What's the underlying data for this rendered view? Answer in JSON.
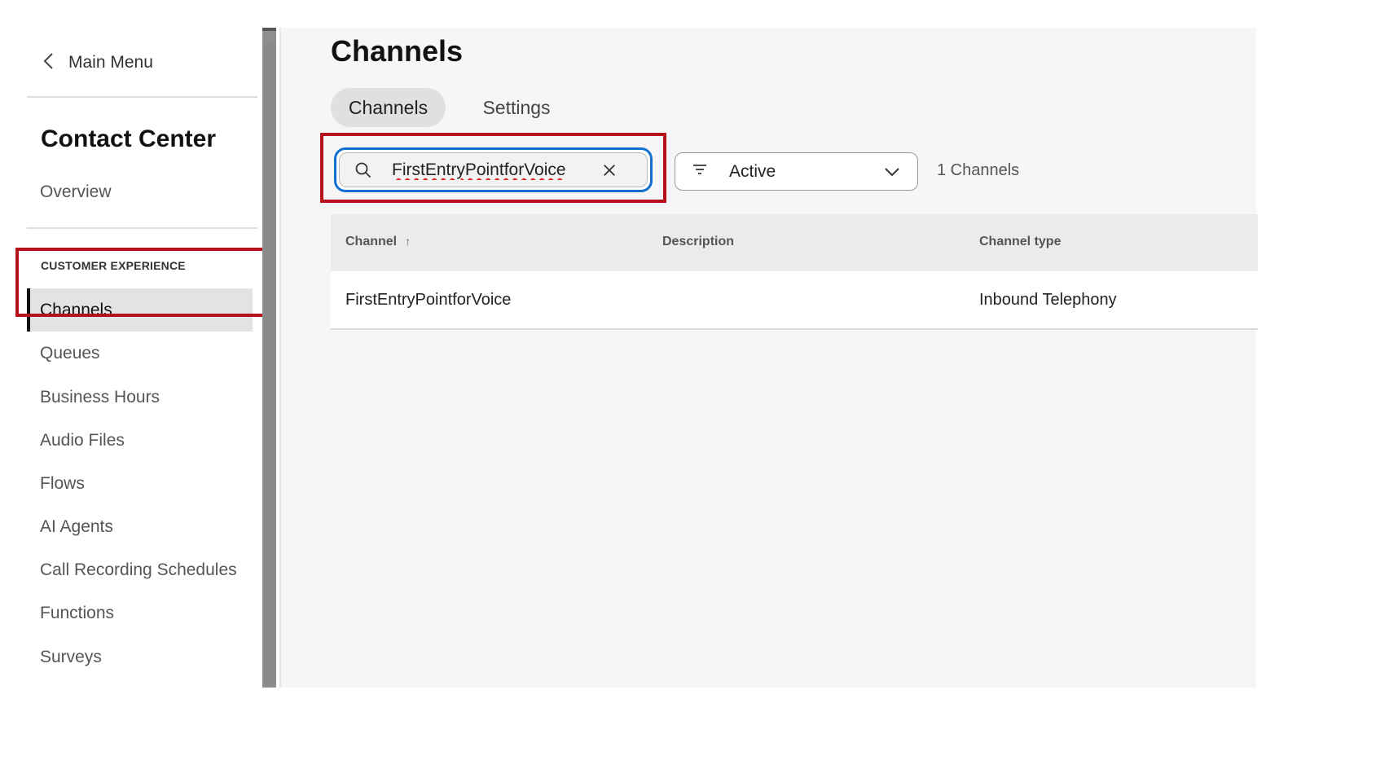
{
  "sidebar": {
    "back_label": "Main Menu",
    "section_title": "Contact Center",
    "overview": "Overview",
    "group_heading": "CUSTOMER EXPERIENCE",
    "items": [
      {
        "label": "Channels",
        "active": true
      },
      {
        "label": "Queues"
      },
      {
        "label": "Business Hours"
      },
      {
        "label": "Audio Files"
      },
      {
        "label": "Flows"
      },
      {
        "label": "AI Agents"
      },
      {
        "label": "Call Recording Schedules"
      },
      {
        "label": "Functions"
      },
      {
        "label": "Surveys"
      }
    ]
  },
  "main": {
    "title": "Channels",
    "tabs": [
      {
        "label": "Channels",
        "active": true
      },
      {
        "label": "Settings"
      }
    ],
    "search": {
      "value": "FirstEntryPointforVoice"
    },
    "filter": {
      "label": "Active"
    },
    "count": "1 Channels",
    "table": {
      "headers": [
        "Channel",
        "Description",
        "Channel type"
      ],
      "sort_indicator": "↑",
      "rows": [
        {
          "channel": "FirstEntryPointforVoice",
          "description": "",
          "type": "Inbound Telephony"
        }
      ]
    }
  },
  "colors": {
    "highlight": "#b5121b",
    "focus_ring": "#1170cf",
    "active_bg": "#e3e3e3"
  },
  "icons": [
    "chevron-left-icon",
    "search-icon",
    "close-icon",
    "filter-icon",
    "chevron-down-icon",
    "sort-up-icon"
  ]
}
